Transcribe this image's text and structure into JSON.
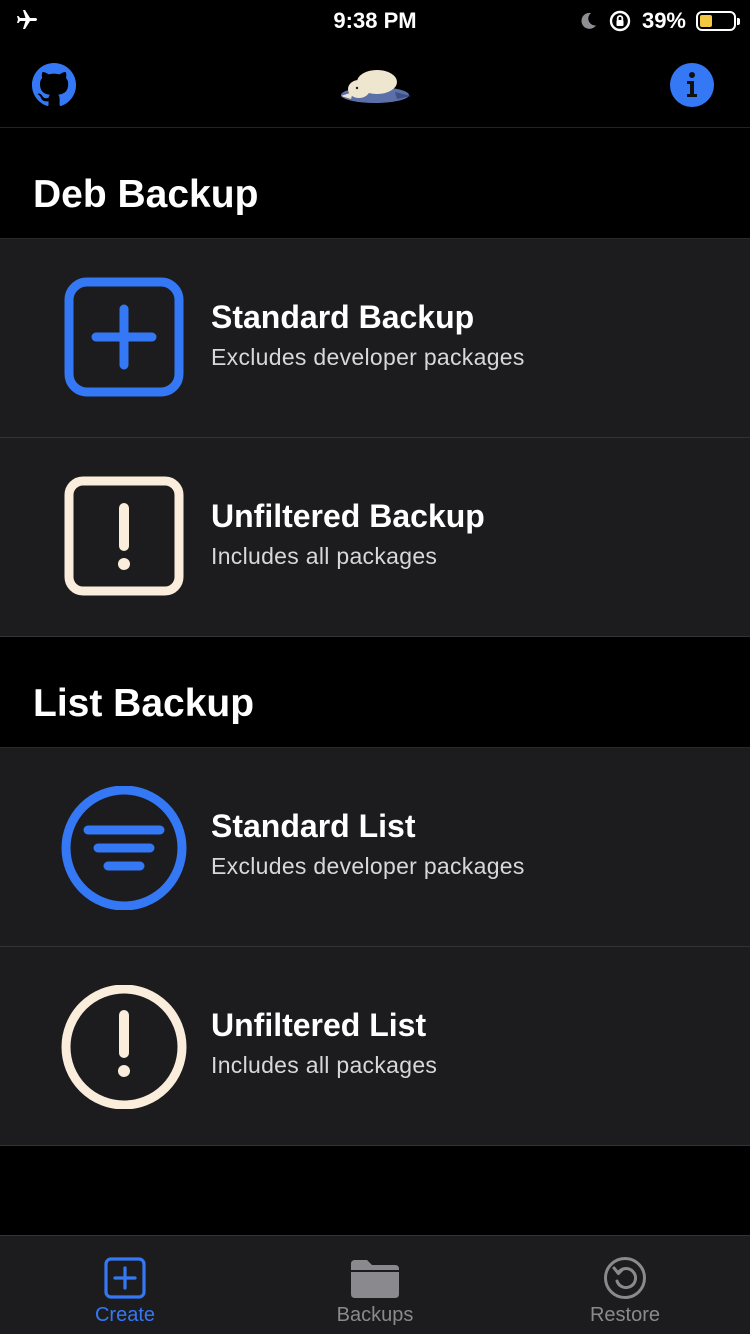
{
  "status_bar": {
    "time": "9:38 PM",
    "battery_percent": "39%",
    "battery_level": 0.39,
    "icons": [
      "airplane-icon",
      "moon-icon",
      "orientation-lock-icon",
      "battery-icon"
    ]
  },
  "nav_bar": {
    "left_icon": "github-icon",
    "center_icon": "mascot-logo",
    "right_icon": "info-icon"
  },
  "sections": [
    {
      "title": "Deb Backup",
      "items": [
        {
          "title": "Standard Backup",
          "subtitle": "Excludes developer packages",
          "icon": "plus-square-icon",
          "color": "#3478f6"
        },
        {
          "title": "Unfiltered Backup",
          "subtitle": "Includes all packages",
          "icon": "exclamation-square-icon",
          "color": "#fbeddc"
        }
      ]
    },
    {
      "title": "List Backup",
      "items": [
        {
          "title": "Standard List",
          "subtitle": "Excludes developer packages",
          "icon": "filter-circle-icon",
          "color": "#3478f6"
        },
        {
          "title": "Unfiltered List",
          "subtitle": "Includes all packages",
          "icon": "exclamation-circle-icon",
          "color": "#fbeddc"
        }
      ]
    }
  ],
  "tab_bar": {
    "tabs": [
      {
        "label": "Create",
        "icon": "plus-square-icon",
        "active": true
      },
      {
        "label": "Backups",
        "icon": "folder-icon",
        "active": false
      },
      {
        "label": "Restore",
        "icon": "restore-icon",
        "active": false
      }
    ]
  },
  "colors": {
    "accent": "#3478f6",
    "cream": "#fbeddc",
    "background": "#000000",
    "cell_background": "#1c1c1e",
    "battery": "#f5c842"
  }
}
